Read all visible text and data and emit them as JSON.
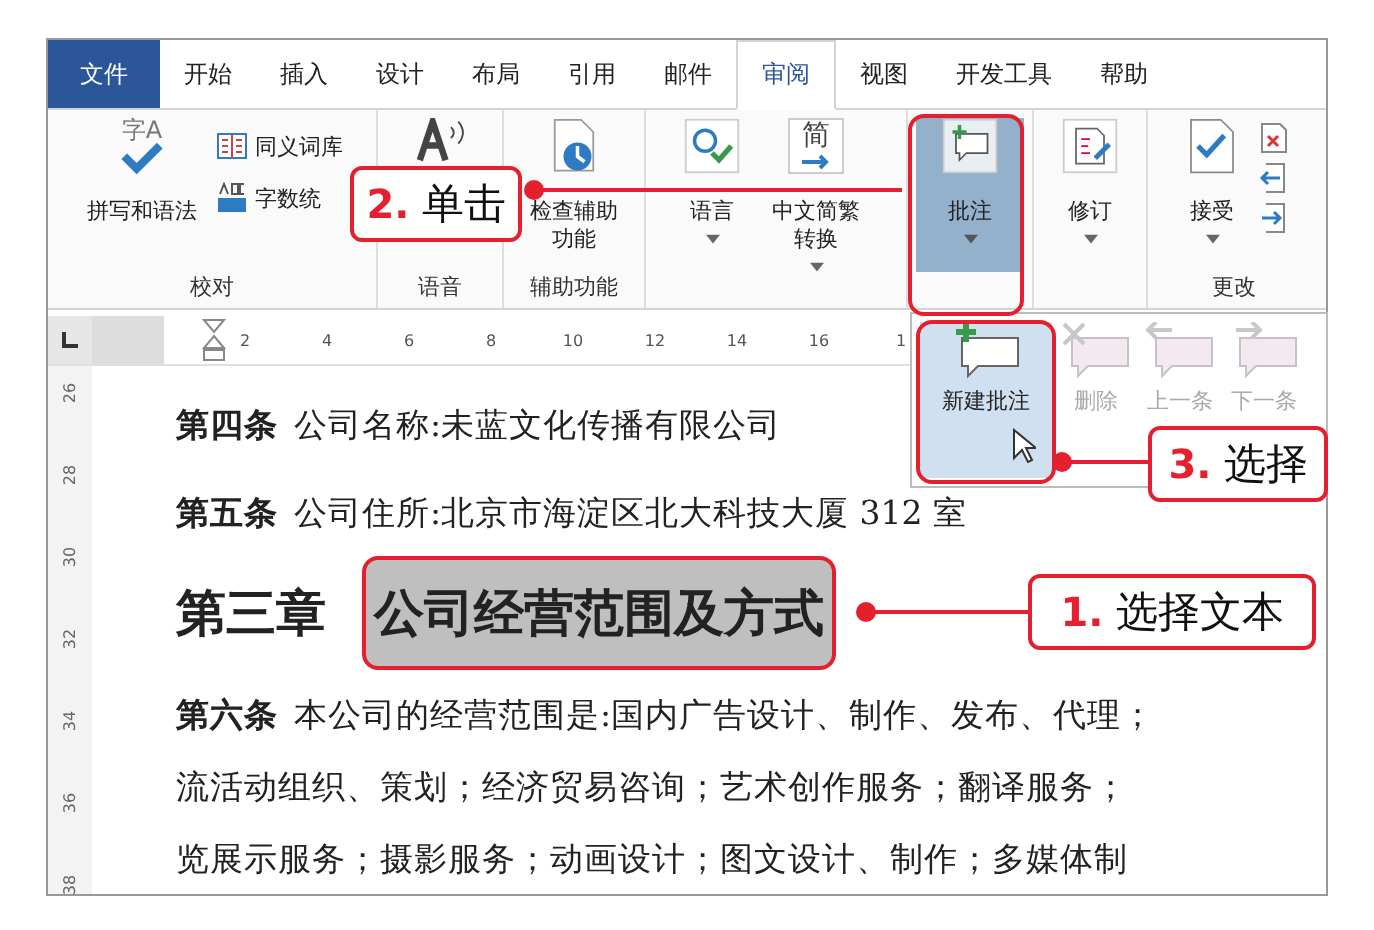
{
  "tabs": [
    {
      "label": "文件",
      "kind": "file",
      "selected": false
    },
    {
      "label": "开始",
      "kind": "tab",
      "selected": false
    },
    {
      "label": "插入",
      "kind": "tab",
      "selected": false
    },
    {
      "label": "设计",
      "kind": "tab",
      "selected": false
    },
    {
      "label": "布局",
      "kind": "tab",
      "selected": false
    },
    {
      "label": "引用",
      "kind": "tab",
      "selected": false
    },
    {
      "label": "邮件",
      "kind": "tab",
      "selected": false
    },
    {
      "label": "审阅",
      "kind": "tab",
      "selected": true
    },
    {
      "label": "视图",
      "kind": "tab",
      "selected": false
    },
    {
      "label": "开发工具",
      "kind": "tab",
      "selected": false
    },
    {
      "label": "帮助",
      "kind": "tab",
      "selected": false
    }
  ],
  "ribbon": {
    "groups": [
      {
        "kind": "proofing",
        "label": "校对",
        "buttons": [
          {
            "label": "拼写和语法",
            "icon_text": "字A"
          },
          {
            "label": "同义词库"
          },
          {
            "label": "字数统"
          }
        ]
      },
      {
        "kind": "speech",
        "label": "语音"
      },
      {
        "kind": "accessibility",
        "label": "辅助功能",
        "buttons": [
          {
            "label": "检查辅助功能"
          }
        ]
      },
      {
        "kind": "language",
        "buttons": [
          {
            "label": "语言",
            "dropdown": true
          },
          {
            "label": "中文简繁转换",
            "dropdown": true,
            "icon_text": "简"
          }
        ]
      },
      {
        "kind": "comments",
        "buttons": [
          {
            "label": "批注",
            "dropdown": true,
            "expanded": true
          }
        ]
      },
      {
        "kind": "tracking",
        "buttons": [
          {
            "label": "修订",
            "dropdown": true
          }
        ]
      },
      {
        "kind": "changes",
        "label": "更改",
        "buttons": [
          {
            "label": "接受",
            "dropdown": true
          }
        ]
      }
    ]
  },
  "comment_menu": {
    "items": [
      {
        "label": "新建批注",
        "highlighted": true,
        "disabled": false
      },
      {
        "label": "删除",
        "highlighted": false,
        "disabled": true
      },
      {
        "label": "上一条",
        "highlighted": false,
        "disabled": true
      },
      {
        "label": "下一条",
        "highlighted": false,
        "disabled": true
      }
    ]
  },
  "ruler": {
    "marks": [
      "2",
      "4",
      "6",
      "8",
      "10",
      "12",
      "14",
      "16",
      "1"
    ]
  },
  "vertical_ruler": {
    "marks": [
      "26",
      "28",
      "30",
      "32",
      "34",
      "36",
      "38"
    ]
  },
  "document": {
    "paragraphs": [
      {
        "kind": "article",
        "number": "第四条",
        "lines": [
          "公司名称:未蓝文化传播有限公司"
        ]
      },
      {
        "kind": "article",
        "number": "第五条",
        "lines": [
          "公司住所:北京市海淀区北大科技大厦 312 室"
        ]
      },
      {
        "kind": "heading",
        "number": "第三章",
        "text": "公司经营范围及方式",
        "selected": true
      },
      {
        "kind": "article",
        "number": "第六条",
        "lines": [
          "本公司的经营范围是:国内广告设计、制作、发布、代理；",
          "流活动组织、策划；经济贸易咨询；艺术创作服务；翻译服务；",
          "览展示服务；摄影服务；动画设计；图文设计、制作；多媒体制"
        ]
      }
    ]
  },
  "callouts": [
    {
      "step": "1.",
      "text": "选择文本"
    },
    {
      "step": "2.",
      "text": "单击"
    },
    {
      "step": "3.",
      "text": "选择"
    }
  ]
}
